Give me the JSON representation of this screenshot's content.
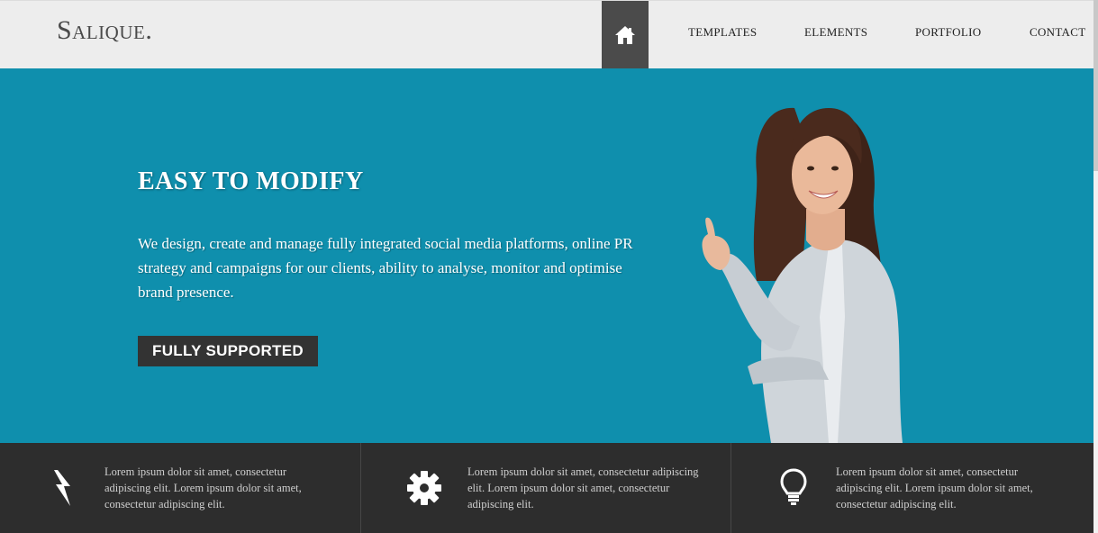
{
  "header": {
    "logo": "Salique.",
    "nav": {
      "home_icon": "home-icon",
      "items": [
        {
          "label": "TEMPLATES"
        },
        {
          "label": "ELEMENTS"
        },
        {
          "label": "PORTFOLIO"
        },
        {
          "label": "CONTACT"
        }
      ]
    }
  },
  "hero": {
    "title": "EASY TO MODIFY",
    "text": "We design, create and manage fully integrated social media platforms, online PR strategy and campaigns for our clients, ability to analyse, monitor and optimise brand presence.",
    "button_label": "FULLY SUPPORTED",
    "image": "smiling-woman-pointing-up"
  },
  "features": [
    {
      "icon": "lightning-icon",
      "text": "Lorem ipsum dolor sit amet, consectetur adipiscing elit. Lorem ipsum dolor sit amet, consectetur adipiscing elit."
    },
    {
      "icon": "gear-icon",
      "text": "Lorem ipsum dolor sit amet, consectetur adipiscing elit. Lorem ipsum dolor sit amet, consectetur adipiscing elit."
    },
    {
      "icon": "lightbulb-icon",
      "text": "Lorem ipsum dolor sit amet, consectetur adipiscing elit. Lorem ipsum dolor sit amet, consectetur adipiscing elit."
    }
  ],
  "colors": {
    "hero_bg": "#0f8fad",
    "header_bg": "#ededed",
    "home_active_bg": "#4b4b4b",
    "button_bg": "#333333",
    "features_bg": "#2d2d2d"
  }
}
